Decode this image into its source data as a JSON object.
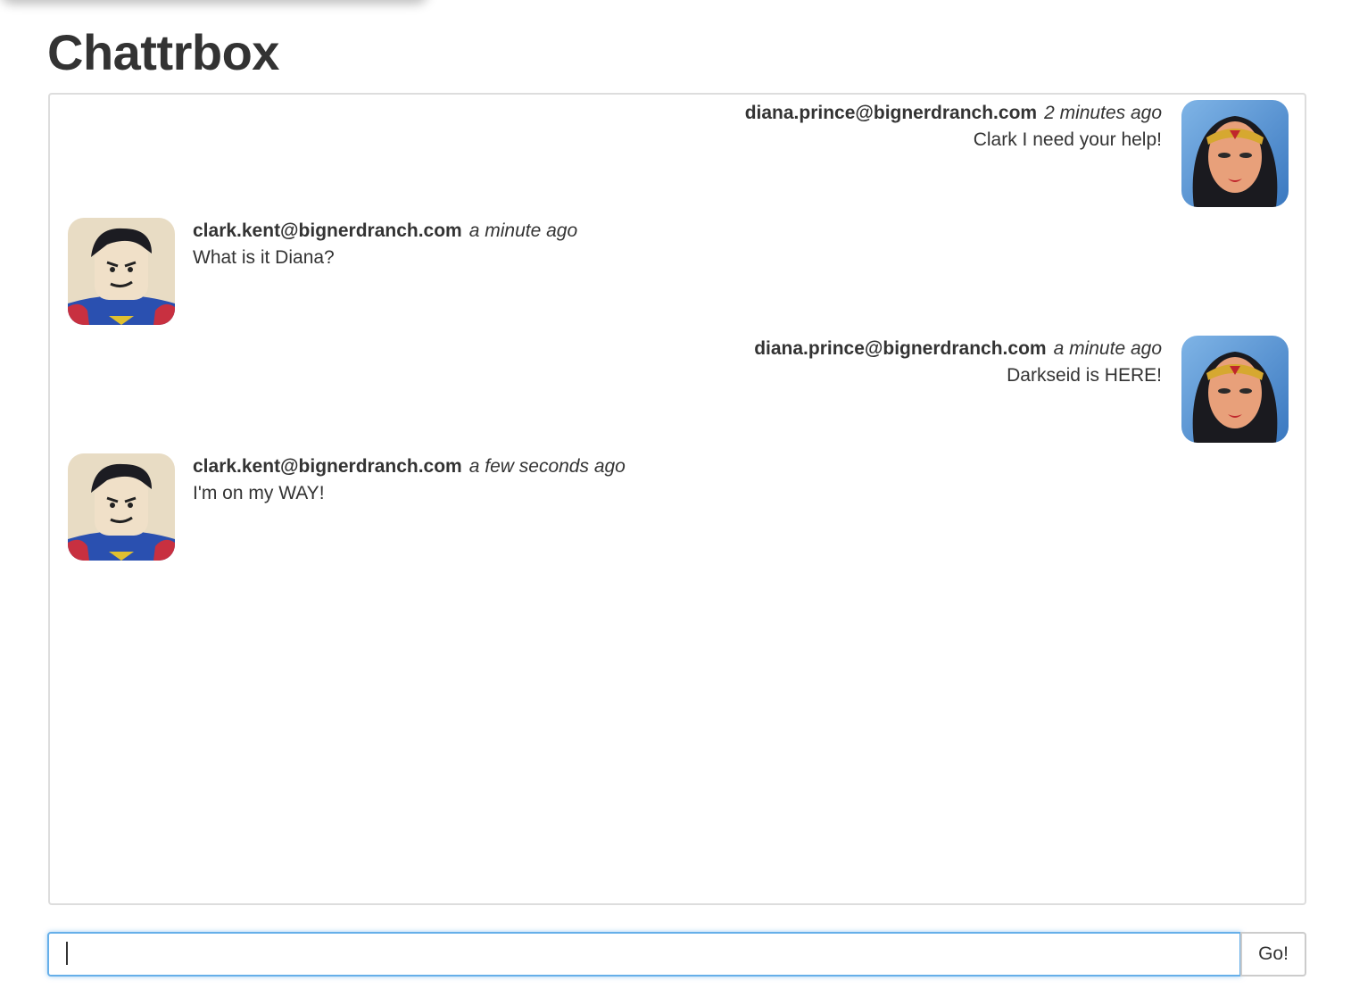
{
  "app": {
    "title": "Chattrbox"
  },
  "messages": [
    {
      "side": "right",
      "sender": "diana.prince@bignerdranch.com",
      "time": "2 minutes ago",
      "text": "Clark I need your help!",
      "avatar_icon": "diana-avatar"
    },
    {
      "side": "left",
      "sender": "clark.kent@bignerdranch.com",
      "time": "a minute ago",
      "text": "What is it Diana?",
      "avatar_icon": "clark-avatar"
    },
    {
      "side": "right",
      "sender": "diana.prince@bignerdranch.com",
      "time": "a minute ago",
      "text": "Darkseid is HERE!",
      "avatar_icon": "diana-avatar"
    },
    {
      "side": "left",
      "sender": "clark.kent@bignerdranch.com",
      "time": "a few seconds ago",
      "text": "I'm on my WAY!",
      "avatar_icon": "clark-avatar"
    }
  ],
  "compose": {
    "input_value": "",
    "placeholder": "",
    "button_label": "Go!"
  },
  "colors": {
    "text": "#333333",
    "border": "#dddddd",
    "focus": "#66afe9"
  }
}
